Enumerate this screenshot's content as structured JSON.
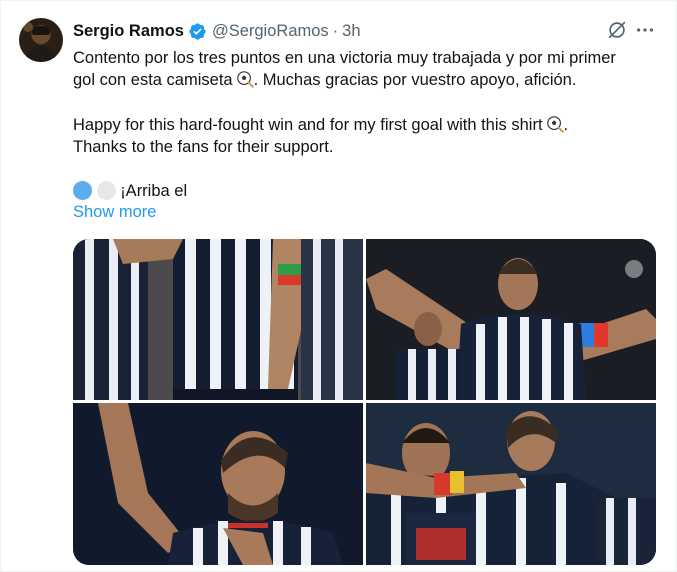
{
  "tweet": {
    "author_name": "Sergio Ramos",
    "author_handle": "@SergioRamos",
    "separator": "·",
    "timestamp": "3h",
    "line1": "Contento por los tres puntos en una victoria muy trabajada y por mi primer",
    "line2": "gol con esta camiseta",
    "line2_tail": ". Muchas gracias por vuestro apoyo, afición.",
    "line3": "Happy for this hard-fought win and for my first goal with this shirt",
    "line3_tail": ".",
    "line4": "Thanks to the fans for their support.",
    "line5": "¡Arriba el",
    "show_more": "Show more"
  },
  "icons": {
    "verified": "verified-badge-icon",
    "grok": "grok-icon",
    "more": "more-options-icon",
    "ball": "soccer-ball-emoji",
    "blue_circle": "blue-circle-emoji",
    "white_circle": "white-circle-emoji"
  },
  "colors": {
    "link": "#1d9bf0",
    "verified": "#1d9bf0",
    "secondary_text": "#536471",
    "primary_text": "#0f1419"
  }
}
